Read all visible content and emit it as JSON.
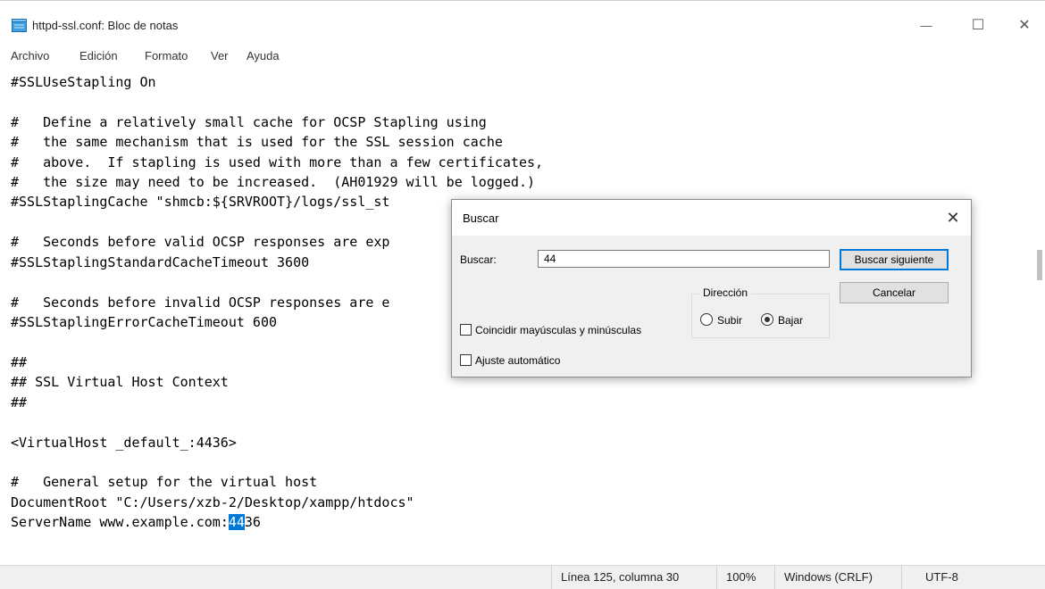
{
  "window": {
    "title": "httpd-ssl.conf: Bloc de notas",
    "minimize_glyph": "—",
    "maximize_glyph": "☐",
    "close_glyph": "✕"
  },
  "menu": [
    "Archivo",
    "Edición",
    "Formato",
    "Ver",
    "Ayuda"
  ],
  "editor": {
    "lines": [
      "#SSLUseStapling On",
      "",
      "#   Define a relatively small cache for OCSP Stapling using",
      "#   the same mechanism that is used for the SSL session cache",
      "#   above.  If stapling is used with more than a few certificates,",
      "#   the size may need to be increased.  (AH01929 will be logged.)",
      "#SSLStaplingCache \"shmcb:${SRVROOT}/logs/ssl_st",
      "",
      "#   Seconds before valid OCSP responses are exp",
      "#SSLStaplingStandardCacheTimeout 3600",
      "",
      "#   Seconds before invalid OCSP responses are e",
      "#SSLStaplingErrorCacheTimeout 600",
      "",
      "##",
      "## SSL Virtual Host Context",
      "##",
      "",
      "<VirtualHost _default_:4436>",
      "",
      "#   General setup for the virtual host",
      "DocumentRoot \"C:/Users/xzb-2/Desktop/xampp/htdocs\""
    ],
    "last_line": {
      "before": "ServerName www.example.com:",
      "selected": "44",
      "after": "36"
    }
  },
  "status": {
    "position": "Línea 125, columna 30",
    "zoom": "100%",
    "line_ending": "Windows (CRLF)",
    "encoding": "UTF-8"
  },
  "find_dialog": {
    "title": "Buscar",
    "close_glyph": "✕",
    "search_label": "Buscar:",
    "search_value": "44",
    "find_next_label": "Buscar siguiente",
    "cancel_label": "Cancelar",
    "direction_label": "Dirección",
    "up_label": "Subir",
    "down_label": "Bajar",
    "down_selected": true,
    "match_case_label": "Coincidir mayúsculas y minúsculas",
    "match_case_checked": false,
    "wrap_label": "Ajuste automático",
    "wrap_checked": false
  },
  "colors": {
    "selection": "#0078d7",
    "dialog_bg": "#f0f0f0",
    "accent": "#0078d7"
  }
}
